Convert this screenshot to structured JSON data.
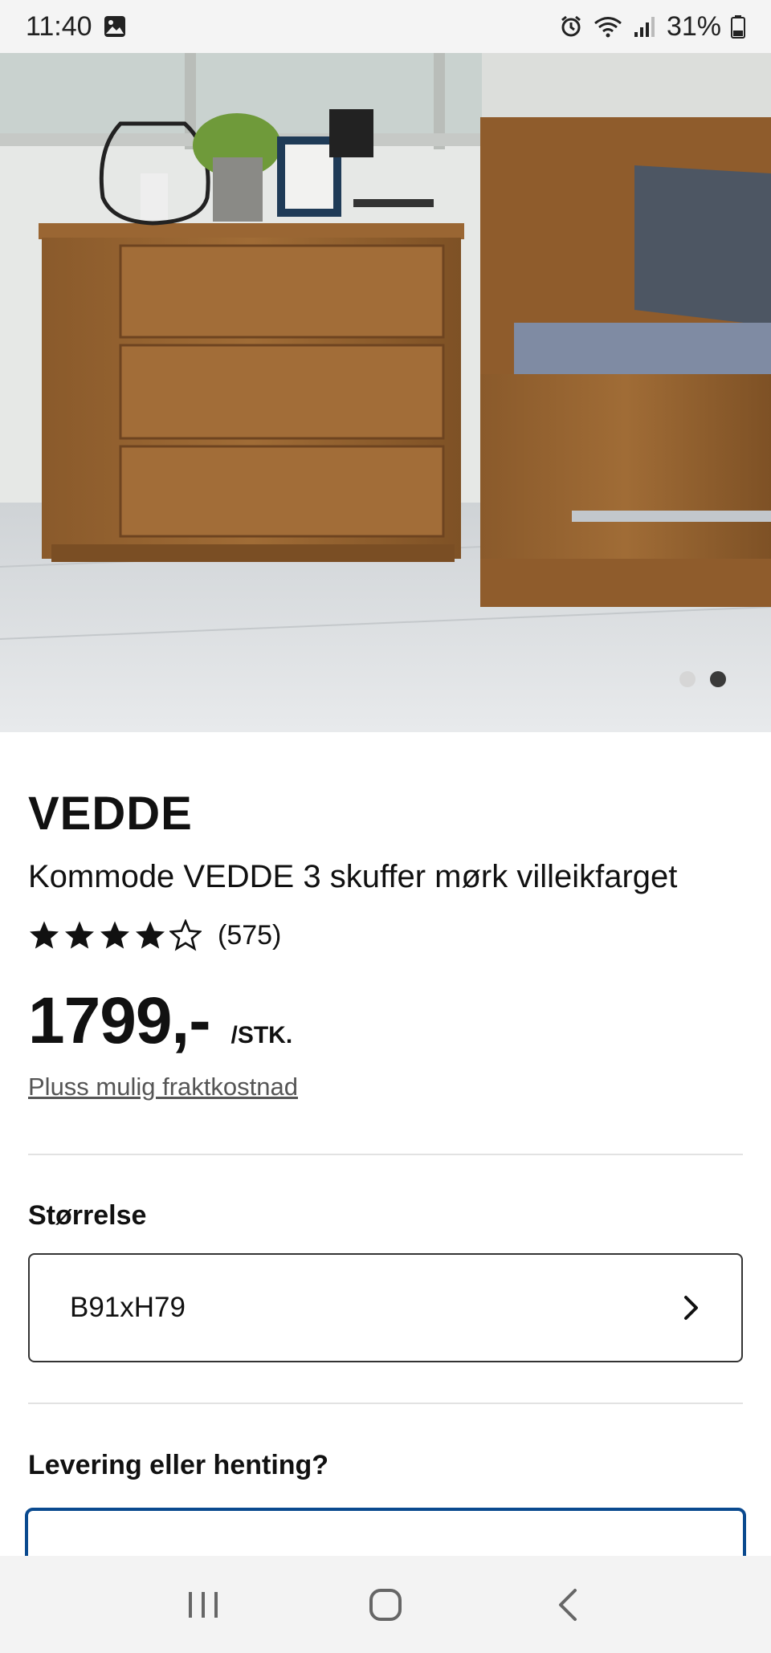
{
  "status": {
    "time": "11:40",
    "battery": "31%",
    "icons": [
      "image-icon",
      "alarm-icon",
      "wifi-icon",
      "signal-icon",
      "battery-icon"
    ]
  },
  "carousel": {
    "slide_count": 2,
    "active_slide": 2,
    "image_alt": "Kommode VEDDE 3 skuffer mørk villeikfarget"
  },
  "product": {
    "brand": "VEDDE",
    "subtitle": "Kommode VEDDE 3 skuffer mørk villeikfarget",
    "rating_stars": 4,
    "rating_max": 5,
    "review_count": "(575)",
    "price": "1799,-",
    "price_unit": "/STK.",
    "shipping_link": "Pluss mulig fraktkostnad"
  },
  "size": {
    "heading": "Størrelse",
    "selected": "B91xH79"
  },
  "delivery": {
    "heading": "Levering eller henting?"
  },
  "navbar": {
    "icons": [
      "recent-apps-icon",
      "home-icon",
      "back-icon"
    ]
  },
  "colors": {
    "brand_blue": "#0a4a8f",
    "text": "#111111",
    "muted": "#555555"
  }
}
